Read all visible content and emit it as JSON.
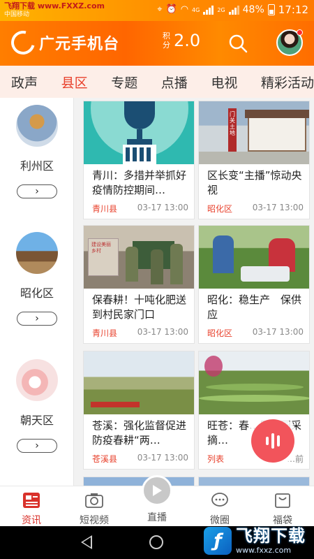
{
  "status_bar": {
    "site_watermark": "飞翔下载 www.FXXZ.com",
    "carrier": "中国移动",
    "network_label": "4G",
    "network_label_2": "2G",
    "battery": "48%",
    "time": "17:12"
  },
  "header": {
    "app_name": "广元手机台",
    "points_label_1": "积",
    "points_label_2": "分",
    "points_value": "2.0"
  },
  "tabs": [
    "政声",
    "县区",
    "专题",
    "点播",
    "电视",
    "精彩活动"
  ],
  "active_tab": 1,
  "districts": [
    {
      "name": "利州区",
      "more": "›"
    },
    {
      "name": "昭化区",
      "more": "›"
    },
    {
      "name": "朝天区",
      "more": "›"
    }
  ],
  "cards": [
    {
      "title": "青川：多措并举抓好疫情防控期间…",
      "source": "青川县",
      "time": "03-17 13:00"
    },
    {
      "title": "区长变“主播”惊动央视",
      "source": "昭化区",
      "time": "03-17 13:00"
    },
    {
      "title": "保春耕！十吨化肥送到村民家门口",
      "source": "青川县",
      "time": "03-17 13:00"
    },
    {
      "title": "昭化：稳生产　保供应",
      "source": "昭化区",
      "time": "03-17 13:00"
    },
    {
      "title": "苍溪：强化监督促进防疫春耕“两…",
      "source": "苍溪县",
      "time": "03-17 13:00"
    },
    {
      "title": "旺苍：春…眉茶园采摘…",
      "source": "列表",
      "time": "…前"
    }
  ],
  "card_image_captions": {
    "card2_sign": "门关土地",
    "card3_sign": "建设美丽乡村"
  },
  "bottom_nav": [
    "资讯",
    "短视频",
    "直播",
    "微圈",
    "福袋"
  ],
  "active_nav": 0,
  "watermark": {
    "title": "飞翔下载",
    "url": "www.fxxz.com"
  },
  "colors": {
    "brand_orange": "#ff7a00",
    "accent_red": "#e8412c",
    "tab_bg": "#fdeee8"
  },
  "icons": [
    "wifi-icon",
    "alarm-icon",
    "location-icon",
    "search-icon",
    "play-icon",
    "audio-wave-icon",
    "news-icon",
    "camera-icon",
    "chat-icon",
    "bag-icon"
  ]
}
